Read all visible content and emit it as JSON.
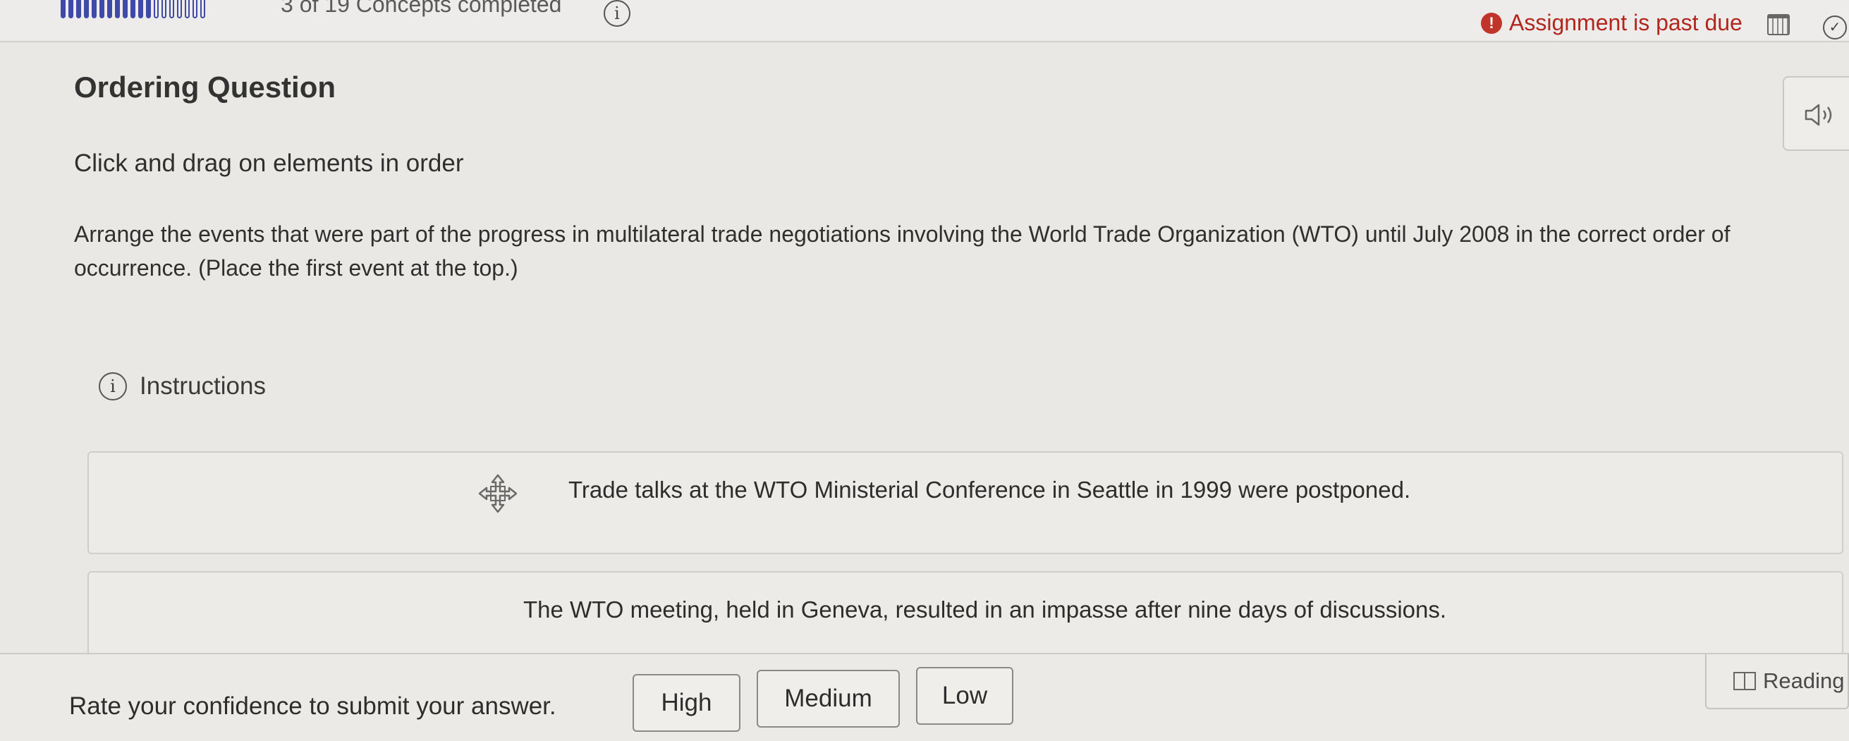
{
  "header": {
    "concepts_text": "3 of 19 Concepts completed",
    "progress": {
      "completed": 3,
      "total": 19
    },
    "info_symbol": "i",
    "past_due_text": "Assignment is past due",
    "alert_symbol": "!",
    "icons": [
      "info-icon",
      "alert-icon",
      "calendar-icon",
      "check-circle-icon"
    ]
  },
  "question": {
    "title": "Ordering Question",
    "subtitle": "Click and drag on elements in order",
    "prompt": "Arrange the events that were part of the progress in multilateral trade negotiations involving the World Trade Organization (WTO) until July 2008 in the correct order of occurrence. (Place the first event at the top.)",
    "instructions_label": "Instructions"
  },
  "cards": [
    {
      "text": "Trade talks at the WTO Ministerial Conference in Seattle in 1999 were postponed."
    },
    {
      "text": "The WTO meeting, held in Geneva, resulted in an impasse after nine days of discussions."
    }
  ],
  "footer": {
    "rate_text": "Rate your confidence to submit your answer.",
    "high_label": "High",
    "medium_label": "Medium",
    "low_label": "Low",
    "reading_label": "Reading"
  },
  "colors": {
    "accent": "#3f4aa8",
    "alert": "#b3261e",
    "background": "#e9e8e4"
  }
}
